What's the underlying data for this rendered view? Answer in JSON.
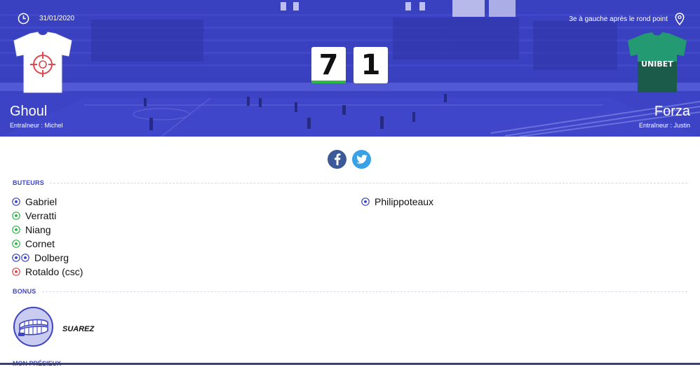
{
  "match": {
    "date": "31/01/2020",
    "location": "3e à gauche après le rond point",
    "home": {
      "name": "Ghoul",
      "coach": "Entraîneur : Michel",
      "score": "7"
    },
    "away": {
      "name": "Forza",
      "coach": "Entraîneur : Justin",
      "score": "1",
      "sponsor": "UNIBET"
    }
  },
  "share": {
    "facebook_icon": "facebook-icon",
    "twitter_icon": "twitter-icon"
  },
  "sections": {
    "scorers_title": "BUTEURS",
    "bonus_title": "BONUS",
    "next_title": "MON PRÉSIEUX"
  },
  "scorers": {
    "home": [
      {
        "name": "Gabriel",
        "balls": [
          "blue"
        ]
      },
      {
        "name": "Verratti",
        "balls": [
          "green"
        ]
      },
      {
        "name": "Niang",
        "balls": [
          "green"
        ]
      },
      {
        "name": "Cornet",
        "balls": [
          "green"
        ]
      },
      {
        "name": "Dolberg",
        "balls": [
          "blue",
          "blue"
        ]
      },
      {
        "name": "Rotaldo (csc)",
        "balls": [
          "red"
        ]
      }
    ],
    "away": [
      {
        "name": "Philippoteaux",
        "balls": [
          "blue"
        ]
      }
    ]
  },
  "bonus": {
    "player": "SUAREZ",
    "icon": "teeth-icon"
  },
  "colors": {
    "accent": "#3e45c4",
    "ball_blue": "#3e45c4",
    "ball_green": "#2db84a",
    "ball_red": "#e0474c"
  }
}
